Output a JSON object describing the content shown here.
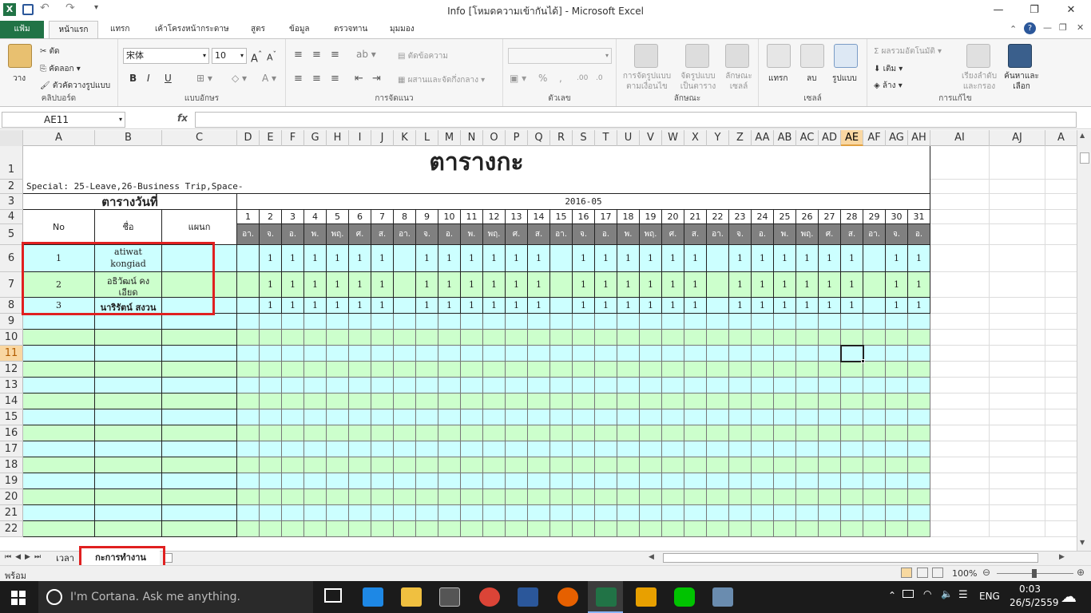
{
  "window": {
    "title": "Info  [โหมดความเข้ากันได้] - Microsoft Excel",
    "minimize": "—",
    "restore": "❐",
    "close": "✕"
  },
  "ribbon_tabs": {
    "file": "แฟ้ม",
    "home": "หน้าแรก",
    "insert": "แทรก",
    "page_layout": "เค้าโครงหน้ากระดาษ",
    "formulas": "สูตร",
    "data": "ข้อมูล",
    "review": "ตรวจทาน",
    "view": "มุมมอง"
  },
  "clipboard": {
    "paste": "วาง",
    "cut": "ตัด",
    "copy": "คัดลอก",
    "format_painter": "ตัวคัดวางรูปแบบ",
    "label": "คลิปบอร์ด"
  },
  "font": {
    "name": "宋体",
    "size": "10",
    "label": "แบบอักษร",
    "bold": "B",
    "italic": "I",
    "underline": "U"
  },
  "alignment": {
    "wrap": "ตัดข้อความ",
    "merge": "ผสานและจัดกึ่งกลาง",
    "label": "การจัดแนว"
  },
  "number": {
    "format_value": "",
    "percent": "%",
    "comma": ",",
    "inc_dec": ".00",
    "dec_dec": ".0",
    "label": "ตัวเลข"
  },
  "styles": {
    "conditional": "การจัดรูปแบบ ตามเงื่อนไข",
    "as_table": "จัดรูปแบบ เป็นตาราง",
    "cell_styles": "ลักษณะ เซลล์",
    "label": "ลักษณะ"
  },
  "cells": {
    "insert": "แทรก",
    "delete": "ลบ",
    "format": "รูปแบบ",
    "label": "เซลล์"
  },
  "editing": {
    "autosum": "ผลรวมอัตโนมัติ",
    "fill": "เติม",
    "clear": "ล้าง",
    "sort": "เรียงลำดับ และกรอง",
    "find": "ค้นหาและ เลือก",
    "label": "การแก้ไข"
  },
  "formula_bar": {
    "name_box": "AE11",
    "fx": "fx",
    "value": ""
  },
  "columns": [
    "A",
    "B",
    "C",
    "D",
    "E",
    "F",
    "G",
    "H",
    "I",
    "J",
    "K",
    "L",
    "M",
    "N",
    "O",
    "P",
    "Q",
    "R",
    "S",
    "T",
    "U",
    "V",
    "W",
    "X",
    "Y",
    "Z",
    "AA",
    "AB",
    "AC",
    "AD",
    "AE",
    "AF",
    "AG",
    "AH",
    "AI",
    "AJ",
    "A"
  ],
  "rows": [
    "1",
    "2",
    "3",
    "4",
    "5",
    "6",
    "7",
    "8",
    "9",
    "10",
    "11",
    "12",
    "13",
    "14",
    "15",
    "16",
    "17",
    "18",
    "19",
    "20",
    "21",
    "22"
  ],
  "sheet": {
    "title": "ตารางกะ",
    "special": "Special: 25-Leave,26-Business Trip,Space-",
    "date_header_label": "ตารางวันที่",
    "month": "2016-05",
    "col_no": "No",
    "col_name": "ชื่อ",
    "col_dept": "แผนก",
    "days": [
      "1",
      "2",
      "3",
      "4",
      "5",
      "6",
      "7",
      "8",
      "9",
      "10",
      "11",
      "12",
      "13",
      "14",
      "15",
      "16",
      "17",
      "18",
      "19",
      "20",
      "21",
      "22",
      "23",
      "24",
      "25",
      "26",
      "27",
      "28",
      "29",
      "30",
      "31"
    ],
    "weekdays": [
      "อา.",
      "จ.",
      "อ.",
      "พ.",
      "พฤ.",
      "ศ.",
      "ส.",
      "อา.",
      "จ.",
      "อ.",
      "พ.",
      "พฤ.",
      "ศ.",
      "ส.",
      "อา.",
      "จ.",
      "อ.",
      "พ.",
      "พฤ.",
      "ศ.",
      "ส.",
      "อา.",
      "จ.",
      "อ.",
      "พ.",
      "พฤ.",
      "ศ.",
      "ส.",
      "อา.",
      "จ.",
      "อ."
    ],
    "employees": [
      {
        "no": "1",
        "name_line1": "atiwat",
        "name_line2": "kongiad",
        "dept": "",
        "shifts": [
          "",
          "1",
          "1",
          "1",
          "1",
          "1",
          "1",
          "",
          "1",
          "1",
          "1",
          "1",
          "1",
          "1",
          "",
          "1",
          "1",
          "1",
          "1",
          "1",
          "1",
          "",
          "1",
          "1",
          "1",
          "1",
          "1",
          "1",
          "",
          "1",
          "1"
        ]
      },
      {
        "no": "2",
        "name_line1": "อธิวัฒน์ คง",
        "name_line2": "เอียด",
        "dept": "",
        "shifts": [
          "",
          "1",
          "1",
          "1",
          "1",
          "1",
          "1",
          "",
          "1",
          "1",
          "1",
          "1",
          "1",
          "1",
          "",
          "1",
          "1",
          "1",
          "1",
          "1",
          "1",
          "",
          "1",
          "1",
          "1",
          "1",
          "1",
          "1",
          "",
          "1",
          "1"
        ]
      },
      {
        "no": "3",
        "name_line1": "นาริรัตน์ สงวน",
        "name_line2": "",
        "dept": "",
        "shifts": [
          "",
          "1",
          "1",
          "1",
          "1",
          "1",
          "1",
          "",
          "1",
          "1",
          "1",
          "1",
          "1",
          "1",
          "",
          "1",
          "1",
          "1",
          "1",
          "1",
          "1",
          "",
          "1",
          "1",
          "1",
          "1",
          "1",
          "1",
          "",
          "1",
          "1"
        ]
      }
    ]
  },
  "sheet_tabs": [
    "เวลา",
    "กะการทำงาน"
  ],
  "status": {
    "ready": "พร้อม",
    "zoom": "100%"
  },
  "taskbar": {
    "cortana": "I'm Cortana. Ask me anything.",
    "lang": "ENG",
    "time": "0:03",
    "date": "26/5/2559"
  },
  "colors": {
    "excel_green": "#217346",
    "row_cyan": "#ccffff",
    "row_green": "#ccffcc",
    "weekday_gray": "#808080",
    "highlight_red": "#e02020"
  }
}
